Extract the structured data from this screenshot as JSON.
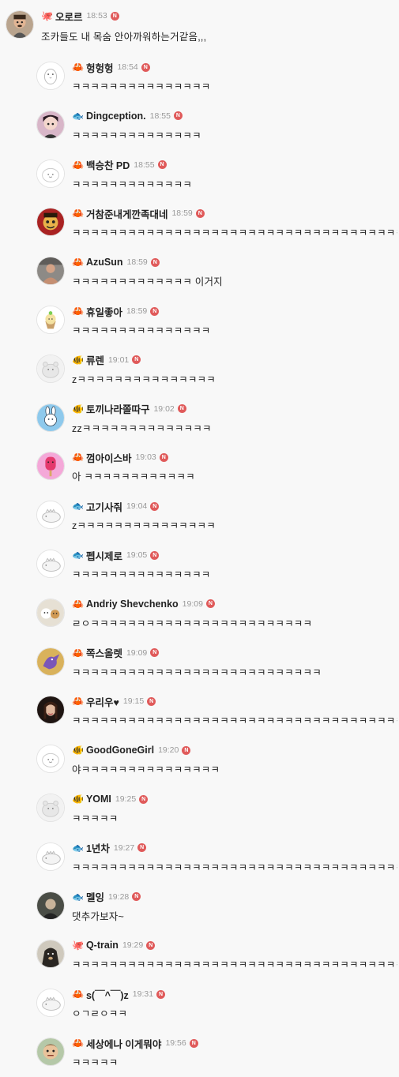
{
  "parent": {
    "badge": "🐙",
    "name": "오로르",
    "time": "18:53",
    "n": "N",
    "text": "조카들도 내 목숨 안아까워하는거같음,,,",
    "avatar": "photo-man"
  },
  "replies": [
    {
      "badge": "🦀",
      "name": "헝헝헝",
      "time": "18:54",
      "n": "N",
      "text": "ㅋㅋㅋㅋㅋㅋㅋㅋㅋㅋㅋㅋㅋㅋㅋ",
      "avatar": "penguin"
    },
    {
      "badge": "🐟",
      "name": "Dingception.",
      "time": "18:55",
      "n": "N",
      "text": "ㅋㅋㅋㅋㅋㅋㅋㅋㅋㅋㅋㅋㅋㅋ",
      "avatar": "anime-girl"
    },
    {
      "badge": "🦀",
      "name": "백승찬 PD",
      "time": "18:55",
      "n": "N",
      "text": "ㅋㅋㅋㅋㅋㅋㅋㅋㅋㅋㅋㅋㅋ",
      "avatar": "blob"
    },
    {
      "badge": "🦀",
      "name": "거참준내게깐족대네",
      "time": "18:59",
      "n": "N",
      "text": "ㅋㅋㅋㅋㅋㅋㅋㅋㅋㅋㅋㅋㅋㅋㅋㅋㅋㅋㅋㅋㅋㅋㅋㅋㅋㅋㅋㅋㅋㅋㅋㅋㅋㅋㅋㅋㅋㅋ",
      "avatar": "cartoon-red"
    },
    {
      "badge": "🦀",
      "name": "AzuSun",
      "time": "18:59",
      "n": "N",
      "text": "ㅋㅋㅋㅋㅋㅋㅋㅋㅋㅋㅋㅋㅋ 이거지",
      "avatar": "photo-gym"
    },
    {
      "badge": "🦀",
      "name": "휴일좋아",
      "time": "18:59",
      "n": "N",
      "text": "ㅋㅋㅋㅋㅋㅋㅋㅋㅋㅋㅋㅋㅋㅋㅋ",
      "avatar": "cupcake"
    },
    {
      "badge": "🐠",
      "name": "류렌",
      "time": "19:01",
      "n": "N",
      "text": "zㅋㅋㅋㅋㅋㅋㅋㅋㅋㅋㅋㅋㅋㅋㅋ",
      "avatar": "hamster"
    },
    {
      "badge": "🐠",
      "name": "토끼나라쫄따구",
      "time": "19:02",
      "n": "N",
      "text": "zzㅋㅋㅋㅋㅋㅋㅋㅋㅋㅋㅋㅋㅋㅋ",
      "avatar": "bunny"
    },
    {
      "badge": "🦀",
      "name": "껌아이스바",
      "time": "19:03",
      "n": "N",
      "text": "아 ㅋㅋㅋㅋㅋㅋㅋㅋㅋㅋㅋㅋ",
      "avatar": "icebar"
    },
    {
      "badge": "🐟",
      "name": "고기사줘",
      "time": "19:04",
      "n": "N",
      "text": "zㅋㅋㅋㅋㅋㅋㅋㅋㅋㅋㅋㅋㅋㅋㅋ",
      "avatar": "dino"
    },
    {
      "badge": "🐟",
      "name": "펩시제로",
      "time": "19:05",
      "n": "N",
      "text": "ㅋㅋㅋㅋㅋㅋㅋㅋㅋㅋㅋㅋㅋㅋㅋ",
      "avatar": "dino"
    },
    {
      "badge": "🦀",
      "name": "Andriy Shevchenko",
      "time": "19:09",
      "n": "N",
      "text": "ㄹㅇㅋㅋㅋㅋㅋㅋㅋㅋㅋㅋㅋㅋㅋㅋㅋㅋㅋㅋㅋㅋㅋㅋㅋㅋ",
      "avatar": "photo-dogs"
    },
    {
      "badge": "🦀",
      "name": "쪽스올렛",
      "time": "19:09",
      "n": "N",
      "text": "ㅋㅋㅋㅋㅋㅋㅋㅋㅋㅋㅋㅋㅋㅋㅋㅋㅋㅋㅋㅋㅋㅋㅋㅋㅋㅋㅋ",
      "avatar": "dragon"
    },
    {
      "badge": "🦀",
      "name": "우리우♥",
      "time": "19:15",
      "n": "N",
      "text": "ㅋㅋㅋㅋㅋㅋㅋㅋㅋㅋㅋㅋㅋㅋㅋㅋㅋㅋㅋㅋㅋㅋㅋㅋㅋㅋㅋㅋㅋㅋㅋㅋㅋㅋㅋㅋㅋㅋㅋㅋㅋ",
      "avatar": "photo-woman"
    },
    {
      "badge": "🐠",
      "name": "GoodGoneGirl",
      "time": "19:20",
      "n": "N",
      "text": "야ㅋㅋㅋㅋㅋㅋㅋㅋㅋㅋㅋㅋㅋㅋㅋ",
      "avatar": "blob"
    },
    {
      "badge": "🐠",
      "name": "YOMI",
      "time": "19:25",
      "n": "N",
      "text": "ㅋㅋㅋㅋㅋ",
      "avatar": "hamster"
    },
    {
      "badge": "🐟",
      "name": "1년차",
      "time": "19:27",
      "n": "N",
      "text": "ㅋㅋㅋㅋㅋㅋㅋㅋㅋㅋㅋㅋㅋㅋㅋㅋㅋㅋㅋㅋㅋㅋㅋㅋㅋㅋㅋㅋㅋㅋㅋㅋㅋㅋㅋㅋㅋㅋㅋㅋㅋㅋㅋ",
      "avatar": "dino"
    },
    {
      "badge": "🐟",
      "name": "멜잉",
      "time": "19:28",
      "n": "N",
      "text": "댓추가보자~",
      "avatar": "photo-dark"
    },
    {
      "badge": "🐙",
      "name": "Q-train",
      "time": "19:29",
      "n": "N",
      "text": "ㅋㅋㅋㅋㅋㅋㅋㅋㅋㅋㅋㅋㅋㅋㅋㅋㅋㅋㅋㅋㅋㅋㅋㅋㅋㅋㅋㅋㅋㅋㅋㅋㅋㅋㅋㅋㅋㅋㅋㅋㅋㅋㅋ",
      "avatar": "photo-dog"
    },
    {
      "badge": "🦀",
      "name": "s(￣^￣)z",
      "time": "19:31",
      "n": "N",
      "text": "ㅇㄱㄹㅇㅋㅋ",
      "avatar": "dino"
    },
    {
      "badge": "🦀",
      "name": "세상에나 이게뭐야",
      "time": "19:56",
      "n": "N",
      "text": "ㅋㅋㅋㅋㅋ",
      "avatar": "cartoon-man"
    }
  ]
}
